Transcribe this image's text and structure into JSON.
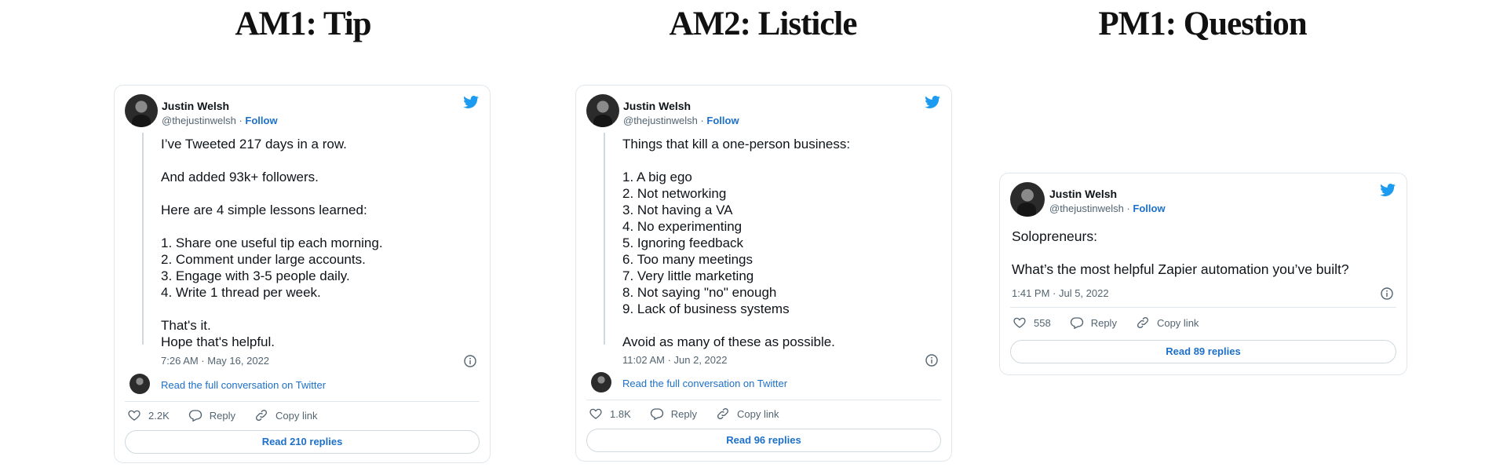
{
  "columns": [
    {
      "title": "AM1: Tip",
      "tweet": {
        "name": "Justin Welsh",
        "handle": "@thejustinwelsh",
        "follow": "Follow",
        "text": "I’ve Tweeted 217 days in a row.\n\nAnd added 93k+ followers.\n\nHere are 4 simple lessons learned:\n\n1. Share one useful tip each morning.\n2. Comment under large accounts.\n3. Engage with 3-5 people daily.\n4. Write 1 thread per week.\n\nThat's it.\nHope that's helpful.",
        "timestamp": "7:26 AM · May 16, 2022",
        "read_full": "Read the full conversation on Twitter",
        "likes": "2.2K",
        "reply": "Reply",
        "copy_link": "Copy link",
        "read_replies": "Read 210 replies"
      }
    },
    {
      "title": "AM2: Listicle",
      "tweet": {
        "name": "Justin Welsh",
        "handle": "@thejustinwelsh",
        "follow": "Follow",
        "text": "Things that kill a one-person business:\n\n1. A big ego\n2. Not networking\n3. Not having a VA\n4. No experimenting\n5. Ignoring feedback\n6. Too many meetings\n7. Very little marketing\n8. Not saying \"no\" enough\n9. Lack of business systems\n\nAvoid as many of these as possible.",
        "timestamp": "11:02 AM · Jun 2, 2022",
        "read_full": "Read the full conversation on Twitter",
        "likes": "1.8K",
        "reply": "Reply",
        "copy_link": "Copy link",
        "read_replies": "Read 96 replies"
      }
    },
    {
      "title": "PM1: Question",
      "tweet": {
        "name": "Justin Welsh",
        "handle": "@thejustinwelsh",
        "follow": "Follow",
        "text": "Solopreneurs:\n\nWhat’s the most helpful Zapier automation you’ve built?",
        "timestamp": "1:41 PM · Jul 5, 2022",
        "likes": "558",
        "reply": "Reply",
        "copy_link": "Copy link",
        "read_replies": "Read 89 replies"
      }
    }
  ],
  "colors": {
    "link": "#1d70c8",
    "twitter_blue": "#1d9bf0",
    "muted": "#536471",
    "border": "#e1e8ed"
  },
  "icons": [
    "twitter-bird-icon",
    "info-icon",
    "heart-icon",
    "reply-icon",
    "link-icon"
  ]
}
